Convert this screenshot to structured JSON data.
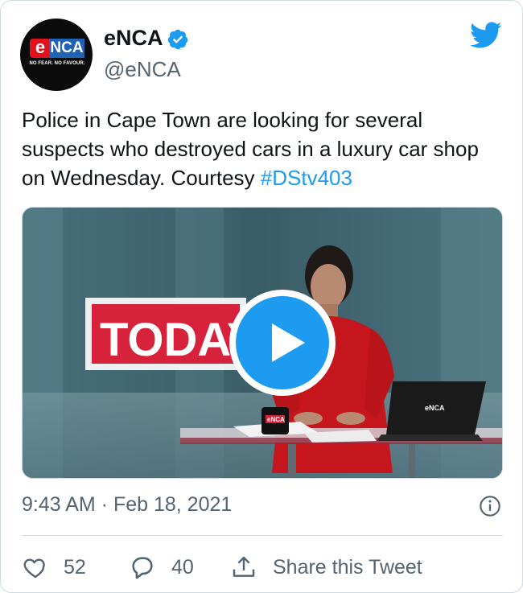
{
  "author": {
    "name": "eNCA",
    "handle": "@eNCA",
    "verified": true,
    "avatar_logo": {
      "e": "e",
      "nca": "NCA",
      "tagline": "NO FEAR. NO FAVOUR."
    }
  },
  "tweet": {
    "text": "Police in Cape Town are looking for several suspects who destroyed cars in a luxury car shop on Wednesday. Courtesy ",
    "hashtag": "#DStv403",
    "timestamp": "9:43 AM · Feb 18, 2021"
  },
  "media": {
    "type": "video",
    "scene_text": "TODAY",
    "desk_logo": "eNCA",
    "mug_logo": "eNCA"
  },
  "actions": {
    "likes": "52",
    "replies": "40",
    "share_label": "Share this Tweet"
  },
  "colors": {
    "accent": "#1d9bf0",
    "text_primary": "#0f1419",
    "text_secondary": "#536471",
    "border": "#cfd9de"
  },
  "icons": [
    "twitter-bird-icon",
    "verified-badge-icon",
    "play-icon",
    "info-icon",
    "heart-icon",
    "reply-icon",
    "share-icon"
  ]
}
